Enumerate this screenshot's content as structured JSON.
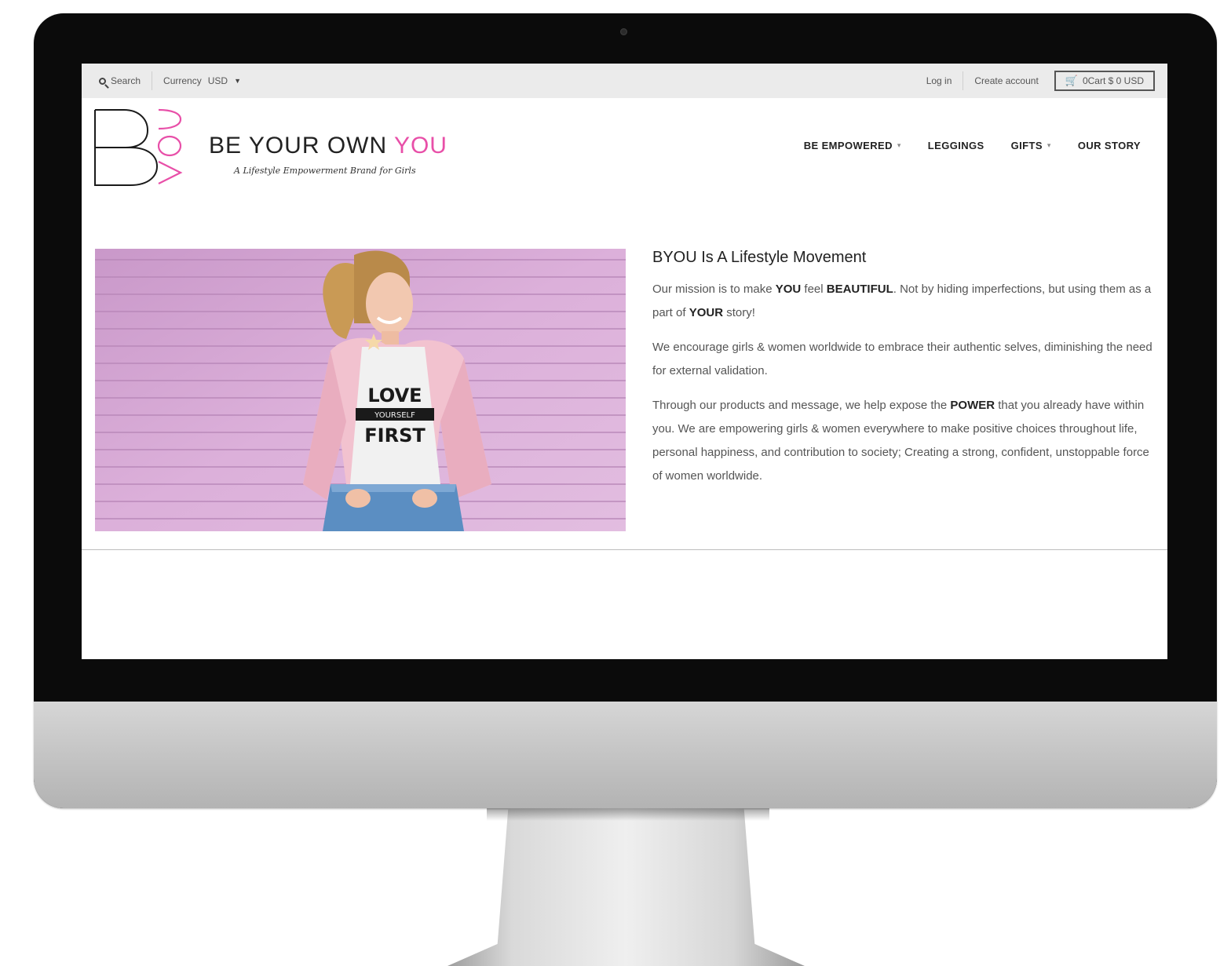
{
  "topbar": {
    "search_label": "Search",
    "currency_label": "Currency",
    "currency_value": "USD",
    "login_label": "Log in",
    "create_account_label": "Create account",
    "cart_label": "0Cart $ 0 USD"
  },
  "header": {
    "logo_letter": "B",
    "logo_you": "YOU",
    "brand_part1": "BE YOUR OWN ",
    "brand_part2": "YOU",
    "tagline": "A Lifestyle Empowerment Brand for Girls",
    "nav": [
      {
        "label": "BE EMPOWERED",
        "has_dropdown": true
      },
      {
        "label": "LEGGINGS",
        "has_dropdown": false
      },
      {
        "label": "GIFTS",
        "has_dropdown": true
      },
      {
        "label": "OUR STORY",
        "has_dropdown": false
      }
    ]
  },
  "hero": {
    "shirt_line1": "LOVE",
    "shirt_line2": "YOURSELF",
    "shirt_line3": "FIRST"
  },
  "content": {
    "heading": "BYOU Is A Lifestyle Movement",
    "p1": [
      {
        "t": "Our mission is to make ",
        "b": false
      },
      {
        "t": "YOU",
        "b": true
      },
      {
        "t": " feel ",
        "b": false
      },
      {
        "t": "BEAUTIFUL",
        "b": true
      },
      {
        "t": ". Not by hiding imperfections, but using them as a part of ",
        "b": false
      },
      {
        "t": "YOUR",
        "b": true
      },
      {
        "t": " story!",
        "b": false
      }
    ],
    "p2": "We encourage girls & women worldwide to embrace their authentic selves, diminishing the need for external validation.",
    "p3": [
      {
        "t": "Through our products and message, we help expose the ",
        "b": false
      },
      {
        "t": "POWER",
        "b": true
      },
      {
        "t": " that you already have within you. We are empowering girls & women everywhere to make positive choices throughout life, personal happiness, and contribution to society; Creating a strong, confident, unstoppable force of women worldwide.",
        "b": false
      }
    ]
  },
  "colors": {
    "brand_pink": "#e84fa8",
    "topbar_bg": "#ebebeb",
    "wall_lavender": "#d7a6d4"
  }
}
